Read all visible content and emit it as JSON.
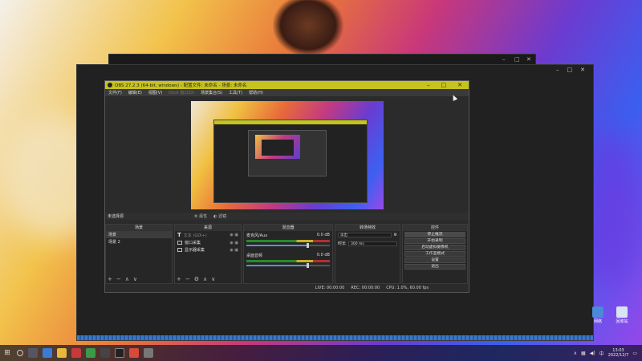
{
  "desktop": {
    "icons": [
      {
        "label": "网络"
      },
      {
        "label": "回收站"
      }
    ]
  },
  "back_window": {
    "minimize": "–",
    "maximize": "□",
    "close": "✕"
  },
  "capture_window": {
    "minimize": "–",
    "maximize": "□",
    "close": "✕"
  },
  "obs": {
    "title": "OBS 27.2.3 (64-bit, windows) - 配置文件: 未命名 - 场景: 未命名",
    "window_controls": {
      "minimize": "–",
      "maximize": "□",
      "close": "✕"
    },
    "menu": [
      "文件(F)",
      "编辑(E)",
      "视图(V)",
      "Dock 窗口(D)",
      "场景集合(S)",
      "工具(T)",
      "帮助(H)"
    ],
    "status_strip": {
      "no_source": "未选择源",
      "properties": "属性",
      "filters": "滤镜"
    },
    "panels": {
      "scenes": {
        "header": "场景",
        "items": [
          "场景",
          "场景 2"
        ],
        "footer": [
          "+",
          "−",
          "∧",
          "∨"
        ]
      },
      "sources": {
        "header": "来源",
        "items": [
          {
            "icon": "text-icon",
            "label": "文本 (GDI+)"
          },
          {
            "icon": "window-icon",
            "label": "窗口采集"
          },
          {
            "icon": "monitor-icon",
            "label": "显示器采集"
          }
        ],
        "footer": [
          "+",
          "−",
          "⚙",
          "∧",
          "∨"
        ]
      },
      "mixer": {
        "header": "混音器",
        "channels": [
          {
            "name": "麦克风/Aux",
            "level": "0.0 dB"
          },
          {
            "name": "桌面音频",
            "level": "0.0 dB"
          }
        ]
      },
      "transitions": {
        "header": "转场特效",
        "type": "淡出",
        "duration_label": "时长",
        "duration_value": "300 ms"
      },
      "controls": {
        "header": "控件",
        "buttons": [
          "停止推流",
          "开始录制",
          "启动虚拟摄像机",
          "工作室模式",
          "设置",
          "退出"
        ]
      }
    },
    "statusbar": {
      "live": "LIVE: 00:00:00",
      "rec": "REC: 00:00:00",
      "cpu": "CPU: 1.0%, 60.00 fps"
    }
  },
  "taskbar": {
    "start": "⊞",
    "time": "13:03",
    "date": "2022/12/7"
  },
  "colors": {
    "obs_titlebar": "#c7c31e",
    "taskbar": "#14142e"
  }
}
